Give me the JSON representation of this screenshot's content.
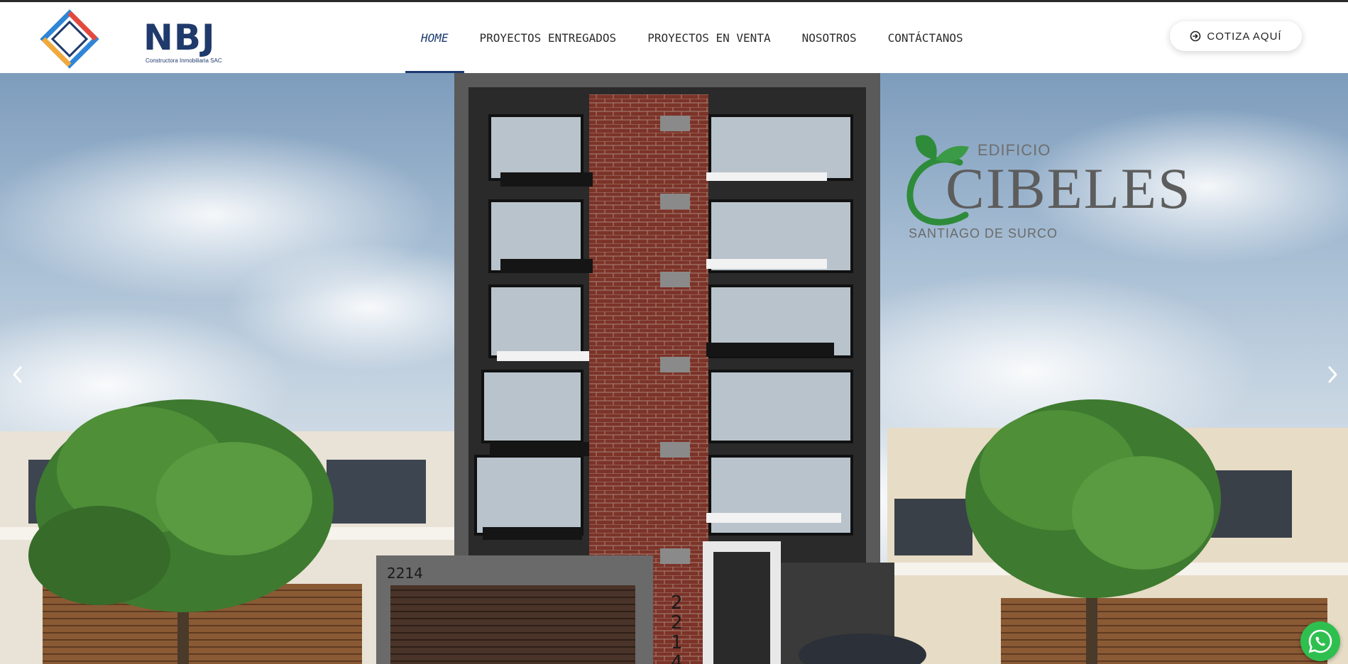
{
  "header": {
    "logo": {
      "wordmark": "NBJ",
      "tagline": "Constructora Inmobiliaria SAC",
      "colors": [
        "#e5483c",
        "#f2a93b",
        "#2f86d6",
        "#1f3a6b"
      ]
    },
    "nav": [
      {
        "label": "HOME",
        "active": true
      },
      {
        "label": "PROYECTOS ENTREGADOS",
        "active": false
      },
      {
        "label": "PROYECTOS EN VENTA",
        "active": false
      },
      {
        "label": "NOSOTROS",
        "active": false
      },
      {
        "label": "CONTÁCTANOS",
        "active": false
      }
    ],
    "cta": {
      "label": "COTIZA AQUÍ",
      "icon": "circle-arrow-right-icon"
    }
  },
  "hero": {
    "brand": {
      "prefix": "EDIFICIO",
      "name": "CIBELES",
      "district": "SANTIAGO DE SURCO",
      "leaf_color": "#2e8b3a"
    },
    "building_numbers": {
      "left": "2214",
      "vertical": "2214"
    },
    "prev_icon": "chevron-left-icon",
    "next_icon": "chevron-right-icon"
  },
  "whatsapp": {
    "icon": "whatsapp-icon",
    "color": "#2fbf4f"
  },
  "colors": {
    "accent": "#1c3a6e",
    "brick": "#7c3328"
  }
}
